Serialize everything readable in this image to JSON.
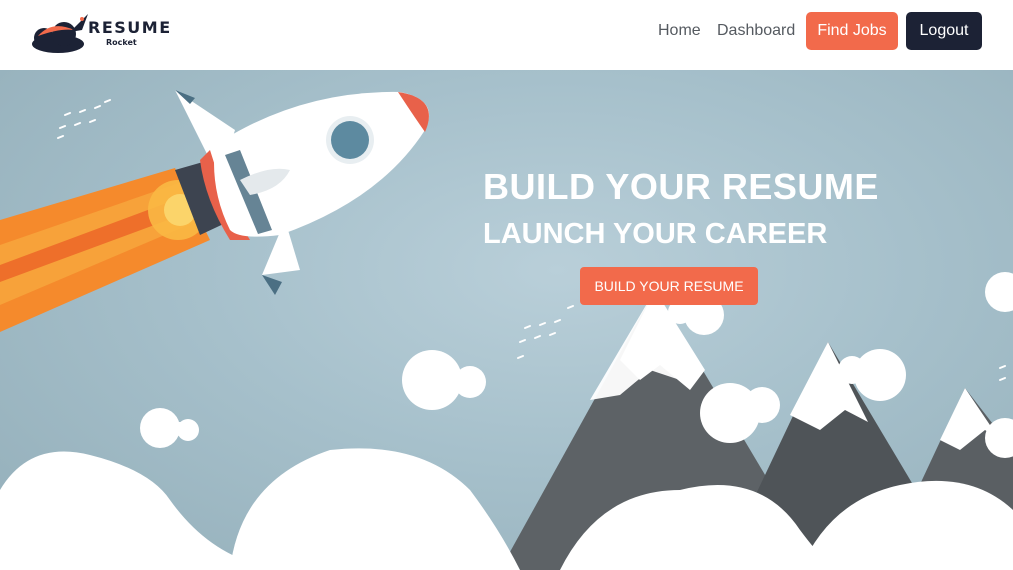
{
  "brand": {
    "title": "RESUME",
    "subtitle": "Rocket",
    "logo_icon": "rocket-cloud-icon"
  },
  "nav": {
    "home_label": "Home",
    "dashboard_label": "Dashboard",
    "find_jobs_label": "Find Jobs",
    "logout_label": "Logout"
  },
  "hero": {
    "headline": "BUILD YOUR RESUME",
    "subheadline": "LAUNCH YOUR CAREER",
    "cta_label": "BUILD YOUR RESUME",
    "illustration_icon": "rocket-icon"
  },
  "colors": {
    "accent": "#f26a4b",
    "dark": "#1c2235",
    "sky": "#a6c0cb",
    "white": "#ffffff"
  }
}
